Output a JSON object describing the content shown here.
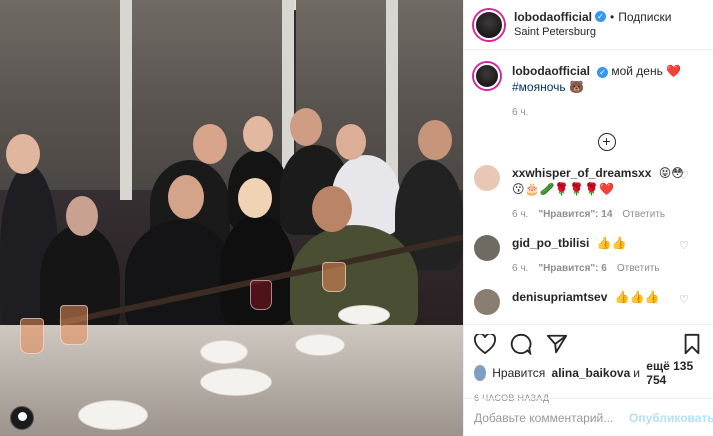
{
  "post": {
    "author": "lobodaofficial",
    "follow_label": "Подписки",
    "location": "Saint Petersburg",
    "caption_text": "мой день",
    "caption_emoji": "❤️",
    "hashtag": "#мояночь",
    "hashtag_emoji": "🐻",
    "caption_time": "6 ч.",
    "likes_prefix": "Нравится",
    "likes_user": "alina_baikova",
    "likes_and": "и",
    "likes_others": "ещё 135 754",
    "posted_ago": "6 ЧАСОВ НАЗАД",
    "comment_placeholder": "Добавьте комментарий...",
    "publish_label": "Опубликовать"
  },
  "comments": [
    {
      "user": "xxwhisper_of_dreamsxx",
      "text": "😝😳😗🎂🥒🌹🌹🌹❤️",
      "time": "6 ч.",
      "likes": "\"Нравится\": 14",
      "reply": "Ответить",
      "avatar_color": "#e8c7b5"
    },
    {
      "user": "gid_po_tbilisi",
      "text": "👍👍",
      "time": "6 ч.",
      "likes": "\"Нравится\": 6",
      "reply": "Ответить",
      "avatar_color": "#6f6a62"
    },
    {
      "user": "denisupriamtsev",
      "text": "👍👍👍",
      "avatar_color": "#8a7e72"
    }
  ],
  "colors": {
    "verified": "#3897f0",
    "link": "#003569",
    "muted": "#8e8e8e",
    "publish": "#b2dffc"
  }
}
